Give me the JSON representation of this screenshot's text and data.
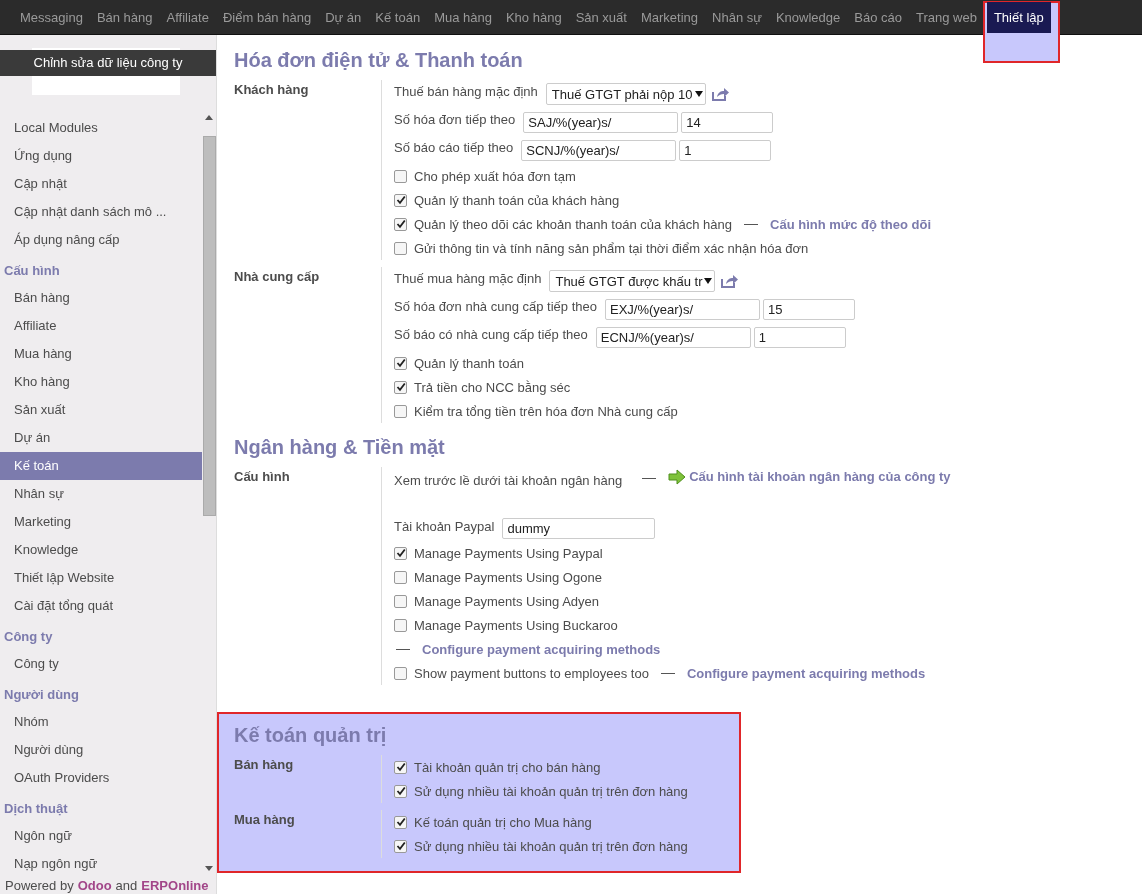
{
  "nav": {
    "items": [
      {
        "label": "Messaging",
        "selected": false,
        "highlighted": false
      },
      {
        "label": "Bán hàng",
        "selected": false,
        "highlighted": false
      },
      {
        "label": "Affiliate",
        "selected": false,
        "highlighted": false
      },
      {
        "label": "Điểm bán hàng",
        "selected": false,
        "highlighted": false
      },
      {
        "label": "Dự án",
        "selected": false,
        "highlighted": false
      },
      {
        "label": "Kế toán",
        "selected": false,
        "highlighted": false
      },
      {
        "label": "Mua hàng",
        "selected": false,
        "highlighted": false
      },
      {
        "label": "Kho hàng",
        "selected": false,
        "highlighted": false
      },
      {
        "label": "Sản xuất",
        "selected": false,
        "highlighted": false
      },
      {
        "label": "Marketing",
        "selected": false,
        "highlighted": false
      },
      {
        "label": "Nhân sự",
        "selected": false,
        "highlighted": false
      },
      {
        "label": "Knowledge",
        "selected": false,
        "highlighted": false
      },
      {
        "label": "Báo cáo",
        "selected": false,
        "highlighted": false
      },
      {
        "label": "Trang web",
        "selected": false,
        "highlighted": false
      },
      {
        "label": "Thiết lập",
        "selected": true,
        "highlighted": true
      }
    ]
  },
  "sidebar": {
    "edit_company": "Chỉnh sửa dữ liệu công ty",
    "groups": [
      {
        "items": [
          {
            "label": "Local Modules",
            "selected": false
          },
          {
            "label": "Ứng dụng",
            "selected": false
          },
          {
            "label": "Cập nhật",
            "selected": false
          },
          {
            "label": "Cập nhật danh sách mô ...",
            "selected": false
          },
          {
            "label": "Áp dụng nâng cấp",
            "selected": false
          }
        ]
      },
      {
        "header": "Cấu hình",
        "items": [
          {
            "label": "Bán hàng",
            "selected": false
          },
          {
            "label": "Affiliate",
            "selected": false
          },
          {
            "label": "Mua hàng",
            "selected": false
          },
          {
            "label": "Kho hàng",
            "selected": false
          },
          {
            "label": "Sản xuất",
            "selected": false
          },
          {
            "label": "Dự án",
            "selected": false
          },
          {
            "label": "Kế toán",
            "selected": true
          },
          {
            "label": "Nhân sự",
            "selected": false
          },
          {
            "label": "Marketing",
            "selected": false
          },
          {
            "label": "Knowledge",
            "selected": false
          },
          {
            "label": "Thiết lập Website",
            "selected": false
          },
          {
            "label": "Cài đặt tổng quát",
            "selected": false
          }
        ]
      },
      {
        "header": "Công ty",
        "items": [
          {
            "label": "Công ty",
            "selected": false
          }
        ]
      },
      {
        "header": "Người dùng",
        "items": [
          {
            "label": "Nhóm",
            "selected": false
          },
          {
            "label": "Người dùng",
            "selected": false
          },
          {
            "label": "OAuth Providers",
            "selected": false
          }
        ]
      },
      {
        "header": "Dịch thuật",
        "items": [
          {
            "label": "Ngôn ngữ",
            "selected": false
          },
          {
            "label": "Nạp ngôn ngữ",
            "selected": false
          }
        ]
      }
    ],
    "footer": [
      {
        "kind": "text",
        "text": "Powered by"
      },
      {
        "kind": "link",
        "text": "Odoo"
      },
      {
        "kind": "text",
        "text": "and"
      },
      {
        "kind": "link",
        "text": "ERPOnline"
      }
    ]
  },
  "sections": [
    {
      "title": "Hóa đơn điện tử & Thanh toán",
      "highlighted": false,
      "groups": [
        {
          "label": "Khách hàng",
          "rows": [
            {
              "kind": "select",
              "label": "Thuế bán hàng mặc định",
              "value": "Thuế GTGT phải nộp 10"
            },
            {
              "kind": "sequence",
              "label": "Số hóa đơn tiếp theo",
              "prefix": "SAJ/%(year)s/",
              "number": "14"
            },
            {
              "kind": "sequence",
              "label": "Số báo cáo tiếp theo",
              "prefix": "SCNJ/%(year)s/",
              "number": "1"
            },
            {
              "kind": "checkbox",
              "label": "Cho phép xuất hóa đơn tạm",
              "checked": false
            },
            {
              "kind": "checkbox",
              "label": "Quản lý thanh toán của khách hàng",
              "checked": true
            },
            {
              "kind": "checkbox",
              "label": "Quản lý theo dõi các khoản thanh toán của khách hàng",
              "checked": true,
              "link": "Cấu hình mức độ theo dõi"
            },
            {
              "kind": "checkbox",
              "label": "Gửi thông tin và tính năng sản phẩm tại thời điểm xác nhận hóa đơn",
              "checked": false
            }
          ]
        },
        {
          "label": "Nhà cung cấp",
          "rows": [
            {
              "kind": "select",
              "label": "Thuế mua hàng mặc định",
              "value": "Thuế GTGT được khấu tr"
            },
            {
              "kind": "sequence",
              "label": "Số hóa đơn nhà cung cấp tiếp theo",
              "prefix": "EXJ/%(year)s/",
              "number": "15"
            },
            {
              "kind": "sequence",
              "label": "Số báo có nhà cung cấp tiếp theo",
              "prefix": "ECNJ/%(year)s/",
              "number": "1"
            },
            {
              "kind": "checkbox",
              "label": "Quản lý thanh toán",
              "checked": true
            },
            {
              "kind": "checkbox",
              "label": "Trả tiền cho NCC bằng séc",
              "checked": true
            },
            {
              "kind": "checkbox",
              "label": "Kiểm tra tổng tiền trên hóa đơn Nhà cung cấp",
              "checked": false
            }
          ]
        }
      ]
    },
    {
      "title": "Ngân hàng & Tiền mặt",
      "highlighted": false,
      "groups": [
        {
          "label": "Cấu hình",
          "rows": [
            {
              "kind": "info",
              "label": "Xem trước lề dưới tài khoản ngân hàng",
              "link": "Cấu hình tài khoản ngân hàng của công ty"
            },
            {
              "kind": "input",
              "label": "Tài khoản Paypal",
              "value": "dummy"
            },
            {
              "kind": "checkbox",
              "label": "Manage Payments Using Paypal",
              "checked": true
            },
            {
              "kind": "checkbox",
              "label": "Manage Payments Using Ogone",
              "checked": false
            },
            {
              "kind": "checkbox",
              "label": "Manage Payments Using Adyen",
              "checked": false
            },
            {
              "kind": "checkbox",
              "label": "Manage Payments Using Buckaroo",
              "checked": false
            },
            {
              "kind": "link",
              "link": "Configure payment acquiring methods"
            },
            {
              "kind": "checkbox",
              "label": "Show payment buttons to employees too",
              "checked": false,
              "link": "Configure payment acquiring methods"
            }
          ]
        }
      ]
    },
    {
      "title": "Kế toán quản trị",
      "highlighted": true,
      "groups": [
        {
          "label": "Bán hàng",
          "rows": [
            {
              "kind": "checkbox",
              "label": "Tài khoản quản trị cho bán hàng",
              "checked": true
            },
            {
              "kind": "checkbox",
              "label": "Sử dụng nhiều tài khoản quản trị trên đơn hàng",
              "checked": true
            }
          ]
        },
        {
          "label": "Mua hàng",
          "rows": [
            {
              "kind": "checkbox",
              "label": "Kế toán quản trị cho Mua hàng",
              "checked": true
            },
            {
              "kind": "checkbox",
              "label": "Sử dụng nhiều tài khoản quản trị trên đơn hàng",
              "checked": true
            }
          ]
        }
      ]
    }
  ]
}
